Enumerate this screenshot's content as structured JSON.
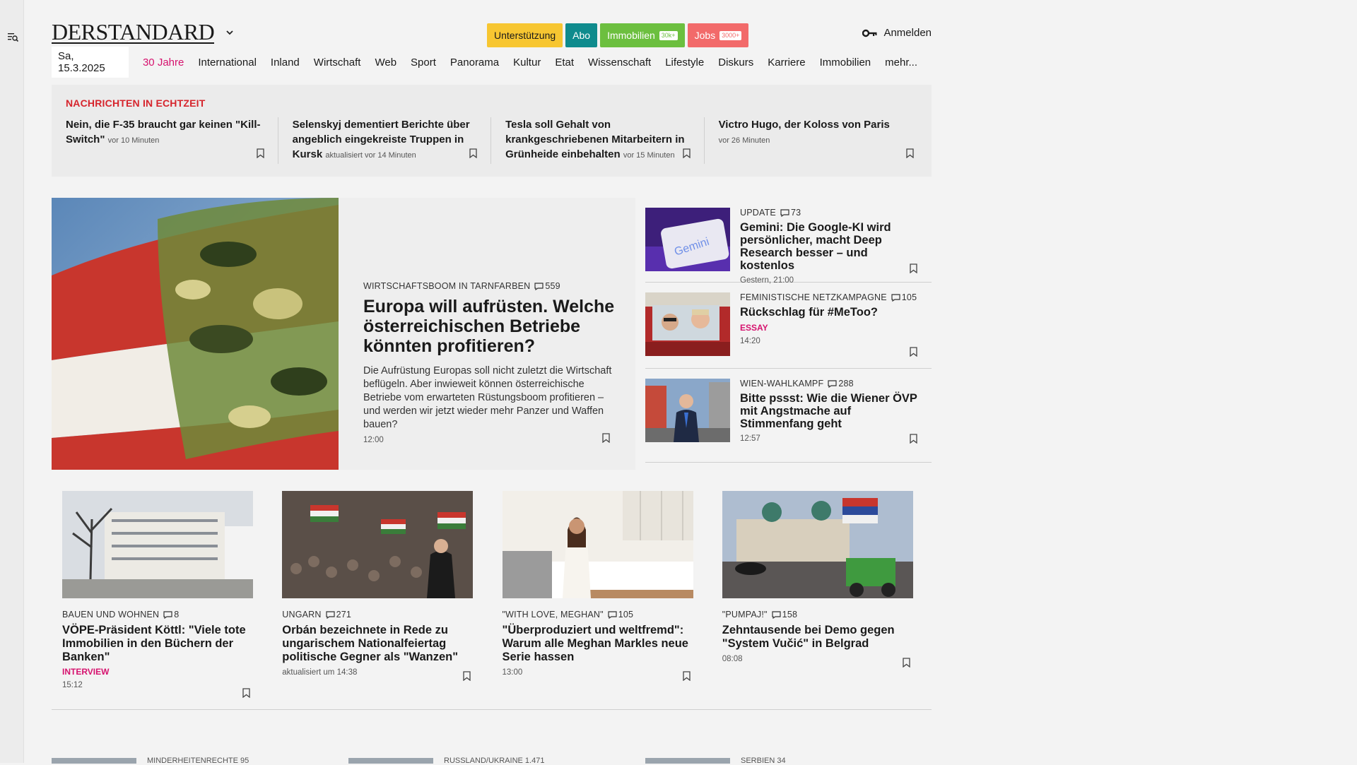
{
  "header": {
    "logo": "DERSTANDARD",
    "promo": [
      {
        "label": "Unterstützung",
        "badge": ""
      },
      {
        "label": "Abo",
        "badge": ""
      },
      {
        "label": "Immobilien",
        "badge": "30k+"
      },
      {
        "label": "Jobs",
        "badge": "3000+"
      }
    ],
    "login": "Anmelden"
  },
  "nav": {
    "date": "Sa, 15.3.2025",
    "items": [
      "30 Jahre",
      "International",
      "Inland",
      "Wirtschaft",
      "Web",
      "Sport",
      "Panorama",
      "Kultur",
      "Etat",
      "Wissenschaft",
      "Lifestyle",
      "Diskurs",
      "Karriere",
      "Immobilien",
      "mehr..."
    ]
  },
  "ticker": {
    "title": "NACHRICHTEN IN ECHTZEIT",
    "items": [
      {
        "title": "Nein, die F-35 braucht gar keinen \"Kill-Switch\"",
        "meta": "vor 10 Minuten"
      },
      {
        "title": "Selenskyj dementiert Berichte über angeblich eingekreiste Truppen in Kursk",
        "meta": "aktualisiert vor 14 Minuten"
      },
      {
        "title": "Tesla soll Gehalt von krankgeschriebenen Mitarbeitern in Grünheide einbehalten",
        "meta": "vor 15 Minuten"
      },
      {
        "title": "Victro Hugo, der Koloss von Paris",
        "meta": "vor 26 Minuten"
      }
    ]
  },
  "hero": {
    "kicker": "WIRTSCHAFTSBOOM IN TARNFARBEN",
    "comments": "559",
    "title": "Europa will aufrüsten. Welche österreichischen Betriebe könnten profitieren?",
    "lead": "Die Aufrüstung Europas soll nicht zuletzt die Wirtschaft beflügeln. Aber inwieweit können österreichische Betriebe vom erwarteten Rüstungsboom profitieren – und werden wir jetzt wieder mehr Panzer und Waffen bauen?",
    "time": "12:00"
  },
  "side": [
    {
      "kicker": "UPDATE",
      "comments": "73",
      "title": "Gemini: Die Google-KI wird persönlicher, macht Deep Research besser – und kostenlos",
      "tag": "",
      "time": "Gestern, 21:00"
    },
    {
      "kicker": "FEMINISTISCHE NETZKAMPAGNE",
      "comments": "105",
      "title": "Rückschlag für #MeToo?",
      "tag": "ESSAY",
      "time": "14:20"
    },
    {
      "kicker": "WIEN-WAHLKAMPF",
      "comments": "288",
      "title": "Bitte pssst: Wie die Wiener ÖVP mit Angstmache auf Stimmenfang geht",
      "tag": "",
      "time": "12:57"
    }
  ],
  "grid": [
    {
      "kicker": "BAUEN UND WOHNEN",
      "comments": "8",
      "title": "VÖPE-Präsident Köttl: \"Viele tote Immobilien in den Büchern der Banken\"",
      "tag": "INTERVIEW",
      "time": "15:12"
    },
    {
      "kicker": "UNGARN",
      "comments": "271",
      "title": "Orbán bezeichnete in Rede zu ungarischem Nationalfeiertag politische Gegner als \"Wanzen\"",
      "tag": "",
      "time": "aktualisiert um 14:38"
    },
    {
      "kicker": "\"WITH LOVE, MEGHAN\"",
      "comments": "105",
      "title": "\"Überproduziert und weltfremd\": Warum alle Meghan Markles neue Serie hassen",
      "tag": "",
      "time": "13:00"
    },
    {
      "kicker": "\"PUMPAJ!\"",
      "comments": "158",
      "title": "Zehntausende bei Demo gegen \"System Vučić\" in Belgrad",
      "tag": "",
      "time": "08:08"
    }
  ],
  "next_row": [
    {
      "kicker": "MINDERHEITENRECHTE",
      "comments": "95"
    },
    {
      "kicker": "RUSSLAND/UKRAINE",
      "comments": "1.471"
    },
    {
      "kicker": "SERBIEN",
      "comments": "34"
    }
  ],
  "icons": {
    "menu": "search-menu-icon",
    "chevron": "chevron-down-icon",
    "key": "key-icon",
    "comment": "comment-icon",
    "bookmark": "bookmark-icon"
  },
  "colors": {
    "accent_magenta": "#d6126e",
    "ticker_red": "#d6242c",
    "promo_yellow": "#f7c631",
    "promo_teal": "#0f8b8d",
    "promo_green": "#6cbf3f",
    "promo_coral": "#f26a6a"
  }
}
